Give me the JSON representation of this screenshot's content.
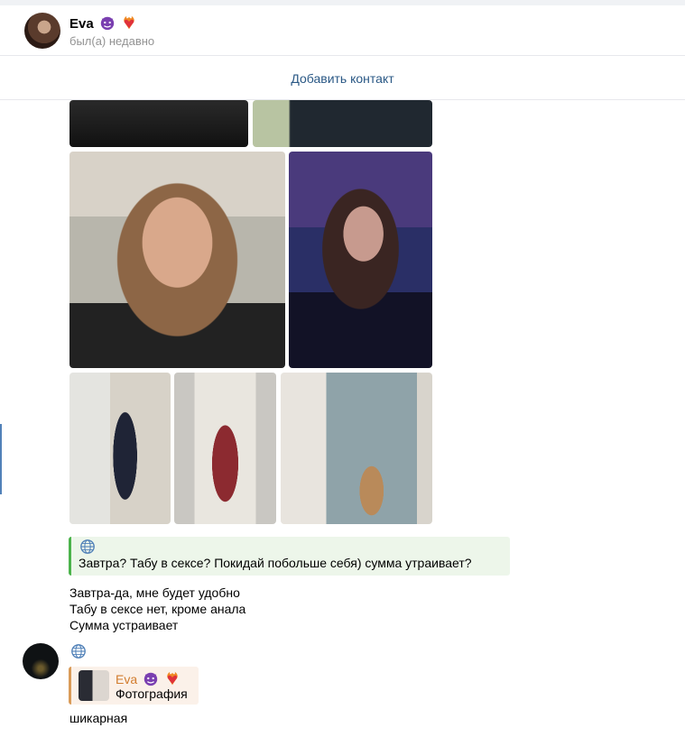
{
  "header": {
    "name": "Eva",
    "name_emojis": [
      "smiling-devil-emoji",
      "heart-on-fire-emoji"
    ],
    "status": "был(а) недавно"
  },
  "contact_bar": {
    "add_contact_label": "Добавить контакт"
  },
  "photo_grid": {
    "icons": [
      "photo-1",
      "photo-2",
      "photo-3",
      "photo-4",
      "photo-5",
      "photo-6",
      "photo-7"
    ]
  },
  "message1": {
    "translated_icon": "globe-icon",
    "quote": "Завтра? Табу в сексе? Покидай побольше себя) сумма утраивает?",
    "lines": [
      "Завтра-да, мне будет удобно",
      "Табу в сексе нет, кроме анала",
      "Сумма устраивает"
    ]
  },
  "message2": {
    "translated_icon": "globe-icon",
    "reply": {
      "author": "Eva",
      "author_emojis": [
        "smiling-devil-emoji",
        "heart-on-fire-emoji"
      ],
      "text": "Фотография"
    },
    "text": "шикарная"
  },
  "colors": {
    "accent": "#2a5885",
    "quote_bar": "#4bb34b",
    "reply_bar": "#d99b58",
    "reply_name": "#d27d2f"
  }
}
